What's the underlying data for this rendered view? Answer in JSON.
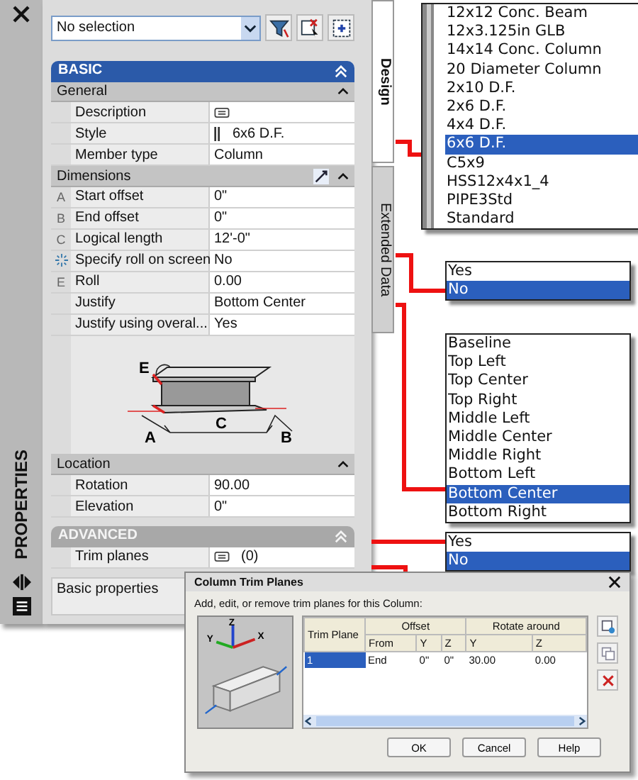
{
  "palette": {
    "title": "PROPERTIES",
    "selector": {
      "value": "No selection"
    },
    "tabs": [
      {
        "label": "Design",
        "selected": true
      },
      {
        "label": "Extended Data",
        "selected": false
      }
    ],
    "sections": [
      {
        "title": "BASIC",
        "kind": "primary",
        "expanded": true,
        "groups": [
          {
            "title": "General",
            "expanded": true,
            "rows": [
              {
                "marker": "",
                "label": "Description",
                "value": "",
                "kind": "note"
              },
              {
                "marker": "",
                "label": "Style",
                "value": "6x6 D.F.",
                "kind": "style"
              },
              {
                "marker": "",
                "label": "Member type",
                "value": "Column",
                "kind": "plain"
              }
            ]
          },
          {
            "title": "Dimensions",
            "expanded": true,
            "tool": true,
            "rows": [
              {
                "marker": "A",
                "label": "Start offset",
                "value": "0\"",
                "kind": "plain"
              },
              {
                "marker": "B",
                "label": "End offset",
                "value": "0\"",
                "kind": "plain"
              },
              {
                "marker": "C",
                "label": "Logical length",
                "value": "12'-0\"",
                "kind": "plain"
              },
              {
                "marker": "",
                "label": "Specify roll on screen",
                "value": "No",
                "kind": "pick"
              },
              {
                "marker": "E",
                "label": "Roll",
                "value": "0.00",
                "kind": "plain"
              },
              {
                "marker": "",
                "label": "Justify",
                "value": "Bottom Center",
                "kind": "plain"
              },
              {
                "marker": "",
                "label": "Justify using overal...",
                "value": "Yes",
                "kind": "plain"
              },
              {
                "kind": "diagram",
                "labels": [
                  "E",
                  "A",
                  "C",
                  "B"
                ]
              }
            ]
          },
          {
            "title": "Location",
            "expanded": true,
            "rows": [
              {
                "marker": "",
                "label": "Rotation",
                "value": "90.00",
                "kind": "plain"
              },
              {
                "marker": "",
                "label": "Elevation",
                "value": "0\"",
                "kind": "plain"
              }
            ]
          }
        ]
      },
      {
        "title": "ADVANCED",
        "kind": "secondary",
        "expanded": true,
        "groups": [
          {
            "rows": [
              {
                "marker": "",
                "label": "Trim planes",
                "value": "(0)",
                "kind": "note"
              }
            ]
          }
        ]
      }
    ],
    "description": "Basic properties"
  },
  "callouts": [
    {
      "kind": "striped",
      "items": [
        {
          "label": "12x12 Conc. Beam",
          "selected": false
        },
        {
          "label": "12x3.125in GLB",
          "selected": false
        },
        {
          "label": "14x14 Conc. Column",
          "selected": false
        },
        {
          "label": "20 Diameter Column",
          "selected": false
        },
        {
          "label": "2x10 D.F.",
          "selected": false
        },
        {
          "label": "2x6 D.F.",
          "selected": false
        },
        {
          "label": "4x4 D.F.",
          "selected": false
        },
        {
          "label": "6x6 D.F.",
          "selected": true
        },
        {
          "label": "C5x9",
          "selected": false
        },
        {
          "label": "HSS12x4x1_4",
          "selected": false
        },
        {
          "label": "PIPE3Std",
          "selected": false
        },
        {
          "label": "Standard",
          "selected": false
        }
      ]
    },
    {
      "kind": "plain",
      "items": [
        {
          "label": "Yes",
          "selected": false
        },
        {
          "label": "No",
          "selected": true
        }
      ]
    },
    {
      "kind": "plain",
      "items": [
        {
          "label": "Baseline",
          "selected": false
        },
        {
          "label": "Top Left",
          "selected": false
        },
        {
          "label": "Top Center",
          "selected": false
        },
        {
          "label": "Top Right",
          "selected": false
        },
        {
          "label": "Middle Left",
          "selected": false
        },
        {
          "label": "Middle Center",
          "selected": false
        },
        {
          "label": "Middle Right",
          "selected": false
        },
        {
          "label": "Bottom Left",
          "selected": false
        },
        {
          "label": "Bottom Center",
          "selected": true
        },
        {
          "label": "Bottom Right",
          "selected": false
        }
      ]
    },
    {
      "kind": "plain",
      "items": [
        {
          "label": "Yes",
          "selected": false
        },
        {
          "label": "No",
          "selected": true
        }
      ]
    }
  ],
  "dialog": {
    "title": "Column Trim Planes",
    "instructions": "Add, edit, or remove trim planes for this Column:",
    "axis_labels": [
      "Z",
      "Y",
      "X"
    ],
    "table": {
      "first_column": "Trim Plane",
      "groups": [
        {
          "label": "Offset",
          "columns": [
            "From",
            "Y",
            "Z"
          ]
        },
        {
          "label": "Rotate around",
          "columns": [
            "Y",
            "Z"
          ]
        }
      ],
      "rows": [
        {
          "selected": true,
          "cells": [
            "1",
            "End",
            "0\"",
            "0\"",
            "30.00",
            "0.00"
          ]
        }
      ]
    },
    "buttons": [
      "OK",
      "Cancel",
      "Help"
    ]
  }
}
